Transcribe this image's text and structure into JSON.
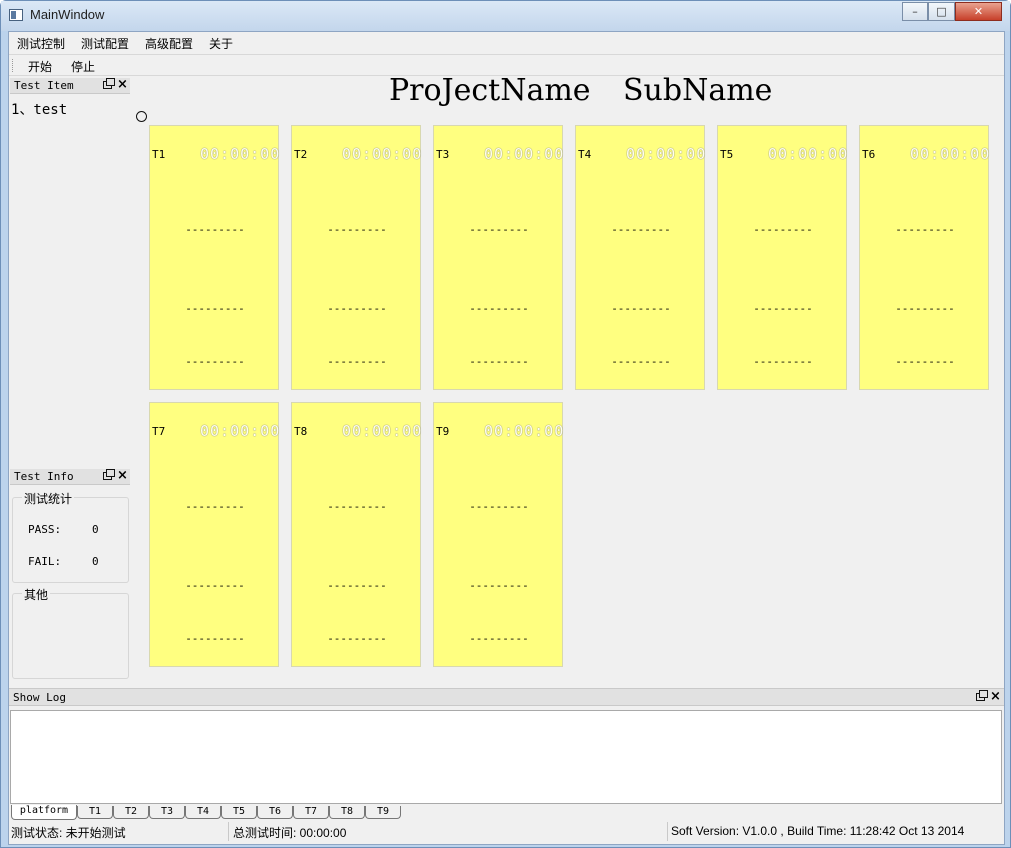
{
  "window": {
    "title": "MainWindow"
  },
  "menubar": [
    "测试控制",
    "测试配置",
    "高级配置",
    "关于"
  ],
  "toolbar": {
    "start": "开始",
    "stop": "停止"
  },
  "test_item_dock": {
    "title": "Test Item",
    "items": [
      "1、test"
    ]
  },
  "test_info_dock": {
    "title": "Test Info",
    "stats_group": "测试统计",
    "pass_label": "PASS:",
    "pass_value": "0",
    "fail_label": "FAIL:",
    "fail_value": "0",
    "other_group": "其他"
  },
  "header": {
    "project": "ProJectName",
    "sub": "SubName"
  },
  "panels": [
    {
      "id": "T1",
      "timer": "00:00:00",
      "line1": "---------",
      "line2": "---------",
      "line3": "---------"
    },
    {
      "id": "T2",
      "timer": "00:00:00",
      "line1": "---------",
      "line2": "---------",
      "line3": "---------"
    },
    {
      "id": "T3",
      "timer": "00:00:00",
      "line1": "---------",
      "line2": "---------",
      "line3": "---------"
    },
    {
      "id": "T4",
      "timer": "00:00:00",
      "line1": "---------",
      "line2": "---------",
      "line3": "---------"
    },
    {
      "id": "T5",
      "timer": "00:00:00",
      "line1": "---------",
      "line2": "---------",
      "line3": "---------"
    },
    {
      "id": "T6",
      "timer": "00:00:00",
      "line1": "---------",
      "line2": "---------",
      "line3": "---------"
    },
    {
      "id": "T7",
      "timer": "00:00:00",
      "line1": "---------",
      "line2": "---------",
      "line3": "---------"
    },
    {
      "id": "T8",
      "timer": "00:00:00",
      "line1": "---------",
      "line2": "---------",
      "line3": "---------"
    },
    {
      "id": "T9",
      "timer": "00:00:00",
      "line1": "---------",
      "line2": "---------",
      "line3": "---------"
    }
  ],
  "log_dock": {
    "title": "Show Log",
    "content": ""
  },
  "tabs": [
    "platform",
    "T1",
    "T2",
    "T3",
    "T4",
    "T5",
    "T6",
    "T7",
    "T8",
    "T9"
  ],
  "statusbar": {
    "state": "测试状态: 未开始测试",
    "total_time": "总测试时间: 00:00:00",
    "version": "Soft Version: V1.0.0 , Build Time: 11:28:42 Oct 13 2014"
  }
}
